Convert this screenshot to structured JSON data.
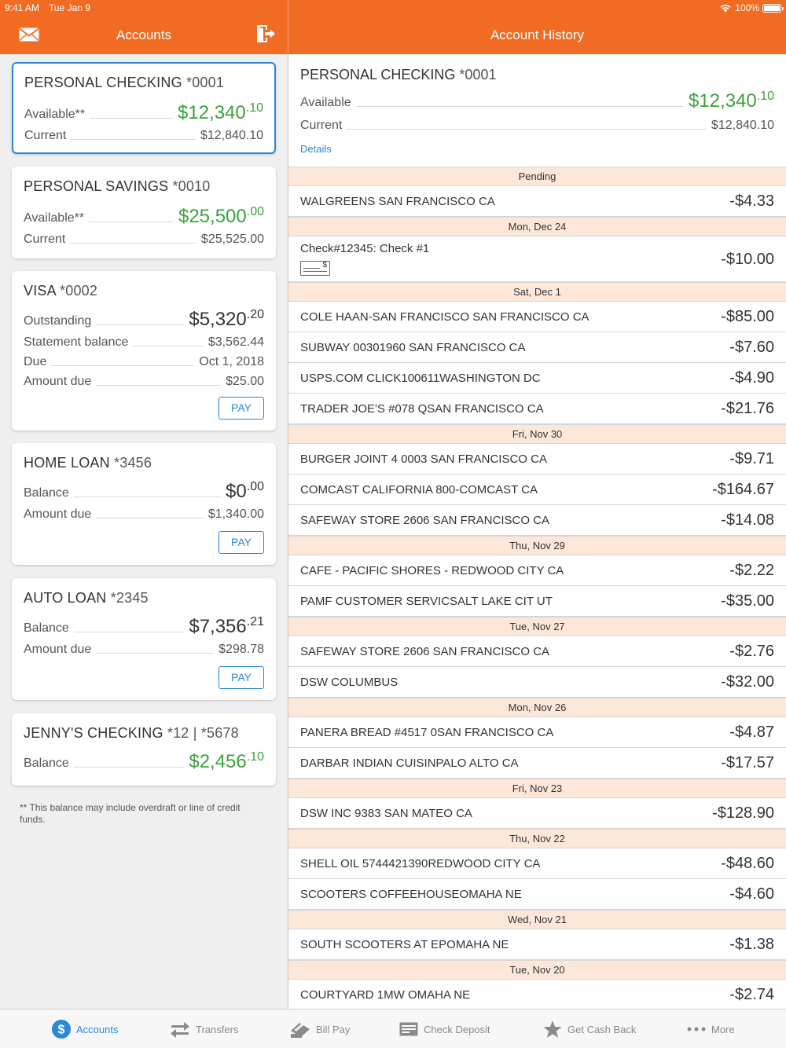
{
  "status": {
    "time": "9:41 AM",
    "date": "Tue Jan 9",
    "battery": "100%"
  },
  "header": {
    "left_title": "Accounts",
    "right_title": "Account History"
  },
  "accounts": [
    {
      "name": "PERSONAL CHECKING",
      "number": "*0001",
      "rows": [
        {
          "label": "Available**",
          "dollars": "$12,340",
          "cents": ".10"
        },
        {
          "label": "Current",
          "value": "$12,840.10"
        }
      ]
    },
    {
      "name": "PERSONAL SAVINGS",
      "number": "*0010",
      "rows": [
        {
          "label": "Available**",
          "dollars": "$25,500",
          "cents": ".00"
        },
        {
          "label": "Current",
          "value": "$25,525.00"
        }
      ]
    },
    {
      "name": "VISA",
      "number": "*0002",
      "pay": "PAY",
      "rows": [
        {
          "label": "Outstanding",
          "dollars": "$5,320",
          "cents": ".20"
        },
        {
          "label": "Statement balance",
          "value": "$3,562.44"
        },
        {
          "label": "Due",
          "value": "Oct 1, 2018"
        },
        {
          "label": "Amount due",
          "value": "$25.00"
        }
      ]
    },
    {
      "name": "HOME LOAN",
      "number": "*3456",
      "pay": "PAY",
      "rows": [
        {
          "label": "Balance",
          "dollars": "$0",
          "cents": ".00"
        },
        {
          "label": "Amount due",
          "value": "$1,340.00"
        }
      ]
    },
    {
      "name": "AUTO LOAN",
      "number": "*2345",
      "pay": "PAY",
      "rows": [
        {
          "label": "Balance",
          "dollars": "$7,356",
          "cents": ".21"
        },
        {
          "label": "Amount due",
          "value": "$298.78"
        }
      ]
    },
    {
      "name": "JENNY'S CHECKING",
      "number": "*12 | *5678",
      "rows": [
        {
          "label": "Balance",
          "dollars": "$2,456",
          "cents": ".10"
        }
      ]
    }
  ],
  "footnote": "** This balance may include overdraft or line of credit funds.",
  "history": {
    "account_name": "PERSONAL CHECKING",
    "account_number": "*0001",
    "available_label": "Available",
    "available_dollars": "$12,340",
    "available_cents": ".10",
    "current_label": "Current",
    "current_value": "$12,840.10",
    "details_link": "Details",
    "groups": [
      {
        "header": "Pending",
        "items": [
          {
            "desc": "WALGREENS SAN FRANCISCO CA",
            "amount": "-$4.33"
          }
        ]
      },
      {
        "header": "Mon, Dec 24",
        "items": [
          {
            "desc": "Check#12345: Check #1",
            "amount": "-$10.00",
            "check": true
          }
        ]
      },
      {
        "header": "Sat, Dec 1",
        "items": [
          {
            "desc": "COLE HAAN-SAN FRANCISCO SAN FRANCISCO CA",
            "amount": "-$85.00"
          },
          {
            "desc": "SUBWAY 00301960 SAN FRANCISCO CA",
            "amount": "-$7.60"
          },
          {
            "desc": "USPS.COM CLICK100611WASHINGTON DC",
            "amount": "-$4.90"
          },
          {
            "desc": "TRADER JOE'S #078 QSAN FRANCISCO CA",
            "amount": "-$21.76"
          }
        ]
      },
      {
        "header": "Fri, Nov 30",
        "items": [
          {
            "desc": "BURGER JOINT 4 0003 SAN FRANCISCO CA",
            "amount": "-$9.71"
          },
          {
            "desc": "COMCAST CALIFORNIA 800-COMCAST CA",
            "amount": "-$164.67"
          },
          {
            "desc": "SAFEWAY STORE 2606 SAN FRANCISCO CA",
            "amount": "-$14.08"
          }
        ]
      },
      {
        "header": "Thu, Nov 29",
        "items": [
          {
            "desc": "CAFE - PACIFIC SHORES - REDWOOD CITY CA",
            "amount": "-$2.22"
          },
          {
            "desc": "PAMF CUSTOMER SERVICSALT LAKE CIT UT",
            "amount": "-$35.00"
          }
        ]
      },
      {
        "header": "Tue, Nov 27",
        "items": [
          {
            "desc": "SAFEWAY STORE 2606 SAN FRANCISCO CA",
            "amount": "-$2.76"
          },
          {
            "desc": "DSW COLUMBUS",
            "amount": "-$32.00"
          }
        ]
      },
      {
        "header": "Mon, Nov 26",
        "items": [
          {
            "desc": "PANERA BREAD #4517 0SAN FRANCISCO CA",
            "amount": "-$4.87"
          },
          {
            "desc": "DARBAR INDIAN CUISINPALO ALTO CA",
            "amount": "-$17.57"
          }
        ]
      },
      {
        "header": "Fri, Nov 23",
        "items": [
          {
            "desc": "DSW INC 9383 SAN MATEO CA",
            "amount": "-$128.90"
          }
        ]
      },
      {
        "header": "Thu, Nov 22",
        "items": [
          {
            "desc": "SHELL OIL 5744421390REDWOOD CITY CA",
            "amount": "-$48.60"
          },
          {
            "desc": "SCOOTERS COFFEEHOUSEOMAHA NE",
            "amount": "-$4.60"
          }
        ]
      },
      {
        "header": "Wed, Nov 21",
        "items": [
          {
            "desc": "SOUTH SCOOTERS AT EPOMAHA NE",
            "amount": "-$1.38"
          }
        ]
      },
      {
        "header": "Tue, Nov 20",
        "items": [
          {
            "desc": "COURTYARD 1MW OMAHA NE",
            "amount": "-$2.74"
          }
        ]
      }
    ]
  },
  "tabs": [
    {
      "label": "Accounts",
      "icon": "dollar-icon",
      "active": true
    },
    {
      "label": "Transfers",
      "icon": "transfer-arrows-icon"
    },
    {
      "label": "Bill Pay",
      "icon": "bill-pay-icon"
    },
    {
      "label": "Check Deposit",
      "icon": "check-deposit-icon"
    },
    {
      "label": "Get Cash Back",
      "icon": "star-icon"
    },
    {
      "label": "More",
      "icon": "more-dots-icon"
    }
  ],
  "colors": {
    "brand": "#f26b22",
    "accent": "#2b87d8",
    "positive": "#3aa23a",
    "section_bg": "#fce7d9"
  }
}
